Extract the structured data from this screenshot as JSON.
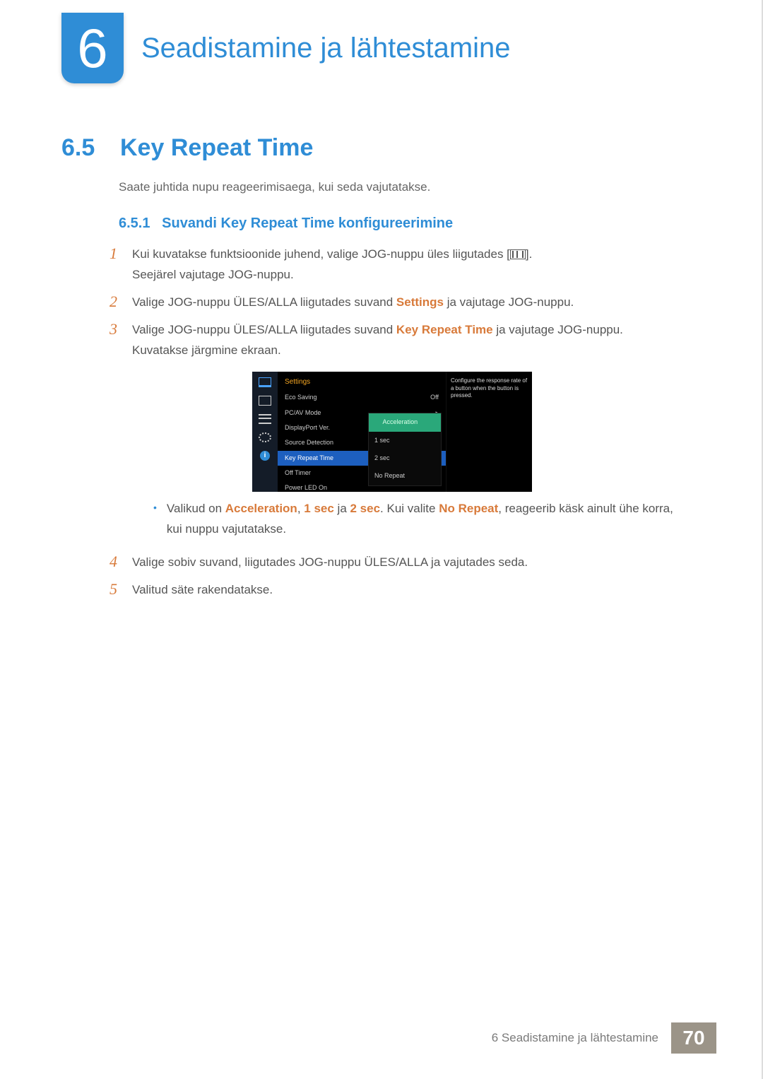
{
  "chapter": {
    "number": "6",
    "title": "Seadistamine ja lähtestamine"
  },
  "section": {
    "number": "6.5",
    "title": "Key Repeat Time",
    "intro": "Saate juhtida nupu reageerimisaega, kui seda vajutatakse."
  },
  "subsection": {
    "number": "6.5.1",
    "title": "Suvandi Key Repeat Time konfigureerimine"
  },
  "steps": {
    "s1": {
      "num": "1",
      "a": "Kui kuvatakse funktsioonide juhend, valige JOG-nuppu üles liigutades [",
      "b": "].",
      "c": "Seejärel vajutage JOG-nuppu."
    },
    "s2": {
      "num": "2",
      "a": "Valige JOG-nuppu ÜLES/ALLA liigutades suvand ",
      "hl": "Settings",
      "b": " ja vajutage JOG-nuppu."
    },
    "s3": {
      "num": "3",
      "a": "Valige JOG-nuppu ÜLES/ALLA liigutades suvand ",
      "hl": "Key Repeat Time",
      "b": " ja vajutage JOG-nuppu.",
      "c": "Kuvatakse järgmine ekraan."
    },
    "bullet": {
      "a": "Valikud on ",
      "h1": "Acceleration",
      "b": ", ",
      "h2": "1 sec",
      "c": " ja ",
      "h3": "2 sec",
      "d": ". Kui valite ",
      "h4": "No Repeat",
      "e": ", reageerib käsk ainult ühe korra, kui nuppu vajutatakse."
    },
    "s4": {
      "num": "4",
      "a": "Valige sobiv suvand, liigutades JOG-nuppu ÜLES/ALLA ja vajutades seda."
    },
    "s5": {
      "num": "5",
      "a": "Valitud säte rakendatakse."
    }
  },
  "osd": {
    "heading": "Settings",
    "rows": {
      "eco": {
        "label": "Eco Saving",
        "val": "Off"
      },
      "pcav": {
        "label": "PC/AV Mode",
        "val": "▸"
      },
      "dp": {
        "label": "DisplayPort Ver.",
        "val": ""
      },
      "src": {
        "label": "Source Detection",
        "val": ""
      },
      "krt": {
        "label": "Key Repeat Time",
        "val": ""
      },
      "off": {
        "label": "Off Timer",
        "val": ""
      },
      "pled": {
        "label": "Power LED On",
        "val": ""
      }
    },
    "popup": {
      "o1": "Acceleration",
      "o2": "1 sec",
      "o3": "2 sec",
      "o4": "No Repeat"
    },
    "help": "Configure the response rate of a button when the button is pressed."
  },
  "footer": {
    "label": "6 Seadistamine ja lähtestamine",
    "page": "70"
  }
}
